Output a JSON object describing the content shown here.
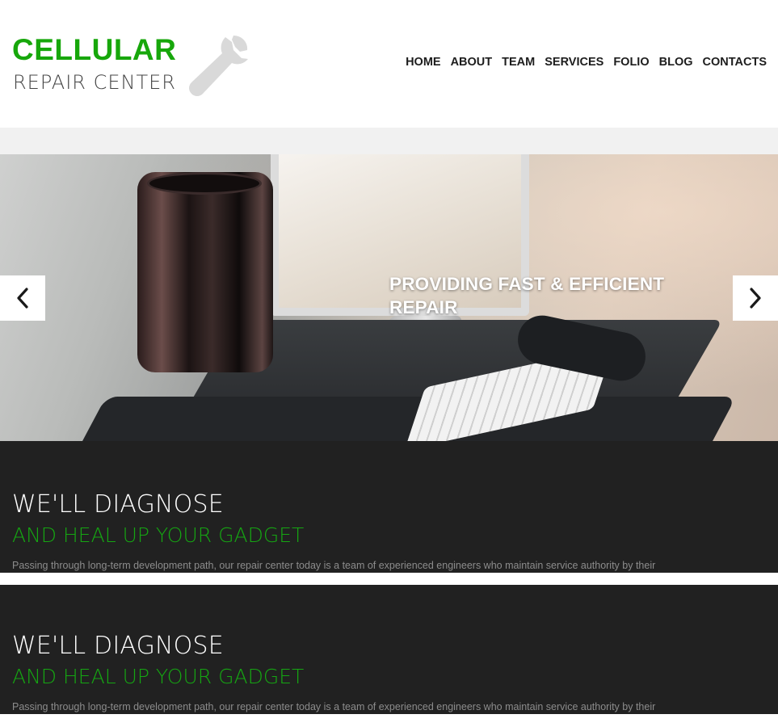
{
  "brand": {
    "title": "CELLULAR",
    "subtitle": "REPAIR CENTER",
    "accent_color": "#17a70b",
    "icon": "wrench-icon"
  },
  "nav": {
    "items": [
      {
        "label": "HOME"
      },
      {
        "label": "ABOUT"
      },
      {
        "label": "TEAM"
      },
      {
        "label": "SERVICES"
      },
      {
        "label": "FOLIO"
      },
      {
        "label": "BLOG"
      },
      {
        "label": "CONTACTS"
      }
    ]
  },
  "slider": {
    "caption": "PROVIDING FAST & EFFICIENT REPAIR",
    "prev_icon": "chevron-left-icon",
    "next_icon": "chevron-right-icon"
  },
  "sections": [
    {
      "heading": "WE'LL DIAGNOSE",
      "subheading": "AND HEAL UP YOUR GADGET",
      "text": "Passing through long-term development path, our repair center today is a team of experienced engineers who maintain service authority by their"
    },
    {
      "heading": "WE'LL DIAGNOSE",
      "subheading": "AND HEAL UP YOUR GADGET",
      "text": "Passing through long-term development path, our repair center today is a team of experienced engineers who maintain service authority by their"
    }
  ],
  "colors": {
    "panel_bg": "#212121",
    "subheading": "#15a612",
    "band": "#f1f1f1"
  }
}
